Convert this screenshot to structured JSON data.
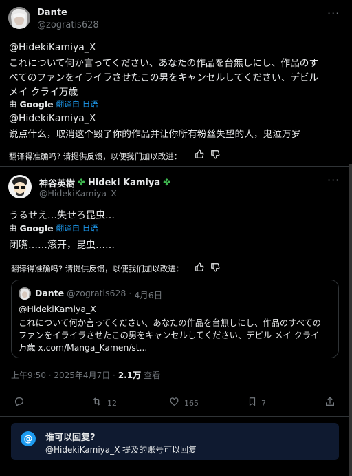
{
  "dante_post": {
    "display_name": "Dante",
    "handle": "@zogratis628",
    "original_mention": "@HidekiKamiya_X",
    "original_text_l1": "これについて何か言ってください、あなたの作品を台無しにし、作品のす",
    "original_text_l2": "べてのファンをイライラさせたこの男をキャンセルしてください、デビル",
    "original_text_l3": "メイ クライ万歳",
    "translated_by_prefix": "由",
    "translated_by_google": "Google",
    "translated_by_suffix": "翻译自 日语",
    "translated_mention": "@HidekiKamiya_X",
    "translated_text": "说点什么，取消这个毁了你的作品并让你所有粉丝失望的人，鬼泣万岁",
    "feedback_text": "翻译得准确吗? 请提供反馈，以便我们加以改进："
  },
  "kamiya_reply": {
    "display_name": "神谷英樹",
    "display_name_en": "Hideki Kamiya",
    "handle": "@HidekiKamiya_X",
    "original_text": "うるせえ…失せろ昆虫…",
    "translated_by_prefix": "由",
    "translated_by_google": "Google",
    "translated_by_suffix": "翻译自 日语",
    "translated_text": "闭嘴……滚开，昆虫……",
    "feedback_text": "翻译得准确吗? 请提供反馈，以便我们加以改进："
  },
  "quote": {
    "display_name": "Dante",
    "handle": "@zogratis628",
    "dot": "·",
    "date": "4月6日",
    "mention": "@HidekiKamiya_X",
    "text_l1": "これについて何か言ってください、あなたの作品を台無しにし、作品のすべての",
    "text_l2": "ファンをイライラさせたこの男をキャンセルしてください、デビル メイ クライ",
    "text_l3": "万歳 x.com/Manga_Kamen/st..."
  },
  "meta": {
    "time": "上午9:50 · 2025年4月7日 ·",
    "views_count": "2.1万",
    "views_label": "查看"
  },
  "actions": {
    "reply_count": "",
    "retweet_count": "12",
    "like_count": "165",
    "bookmark_count": "7"
  },
  "who_can_reply": {
    "title": "谁可以回复?",
    "desc": "@HidekiKamiya_X 提及的账号可以回复"
  },
  "colors": {
    "background": "#000000",
    "accent": "#1d9bf0",
    "banner": "#0f1a30",
    "clover": "#3fb950"
  }
}
